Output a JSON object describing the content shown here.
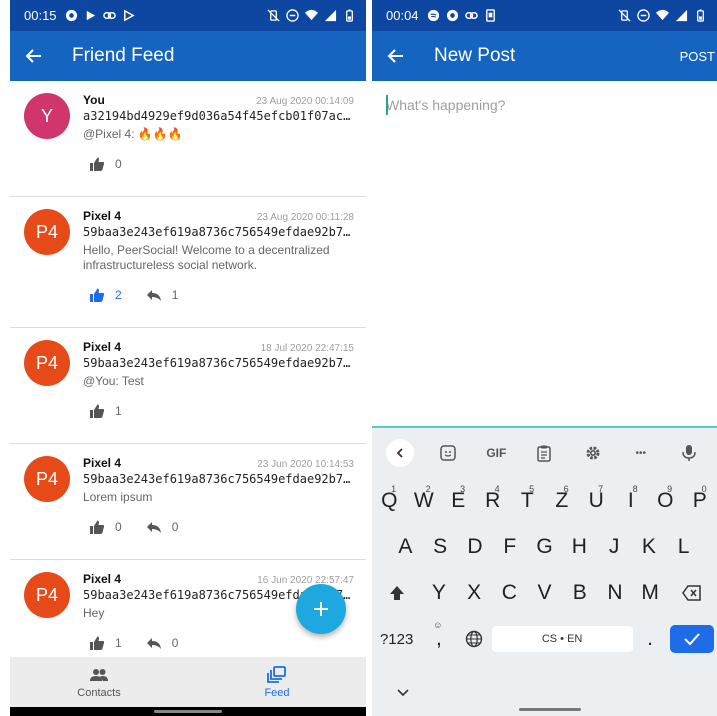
{
  "colors": {
    "statusbar": "#0d47a1",
    "appbar": "#1565c0",
    "accent": "#1e6ce8",
    "fab": "#1fa8e0",
    "avatar_you": "#d0356b",
    "avatar_p4": "#e64a19"
  },
  "left": {
    "status": {
      "time": "00:15"
    },
    "appbar": {
      "title": "Friend Feed"
    },
    "posts": [
      {
        "avatar": "Y",
        "author": "You",
        "date": "23 Aug 2020 00:14:09",
        "hash": "a32194bd4929ef9d036a54f45efcb01f07ac…",
        "message": "@Pixel 4: 🔥🔥🔥",
        "likes": "0",
        "liked": false,
        "replies": null
      },
      {
        "avatar": "P4",
        "author": "Pixel 4",
        "date": "23 Aug 2020 00:11:28",
        "hash": "59baa3e243ef619a8736c756549efdae92b7…",
        "message": "Hello, PeerSocial! Welcome to a decentralized infrastructureless social network.",
        "likes": "2",
        "liked": true,
        "replies": "1"
      },
      {
        "avatar": "P4",
        "author": "Pixel 4",
        "date": "18 Jul 2020 22:47:15",
        "hash": "59baa3e243ef619a8736c756549efdae92b7…",
        "message": "@You: Test",
        "likes": "1",
        "liked": false,
        "replies": null
      },
      {
        "avatar": "P4",
        "author": "Pixel 4",
        "date": "23 Jun 2020 10:14:53",
        "hash": "59baa3e243ef619a8736c756549efdae92b7…",
        "message": "Lorem ipsum",
        "likes": "0",
        "liked": false,
        "replies": "0"
      },
      {
        "avatar": "P4",
        "author": "Pixel 4",
        "date": "16 Jun 2020 22:57:47",
        "hash": "59baa3e243ef619a8736c756549efdae92b7…",
        "message": "Hey",
        "likes": "1",
        "liked": false,
        "replies": "0"
      }
    ],
    "nav": {
      "contacts": "Contacts",
      "feed": "Feed"
    }
  },
  "right": {
    "status": {
      "time": "00:04"
    },
    "appbar": {
      "title": "New Post",
      "action": "POST"
    },
    "compose": {
      "placeholder": "What's happening?"
    },
    "keyboard": {
      "gif": "GIF",
      "more": "•••",
      "row1": [
        [
          "Q",
          "1"
        ],
        [
          "W",
          "2"
        ],
        [
          "E",
          "3"
        ],
        [
          "R",
          "4"
        ],
        [
          "T",
          "5"
        ],
        [
          "Z",
          "6"
        ],
        [
          "U",
          "7"
        ],
        [
          "I",
          "8"
        ],
        [
          "O",
          "9"
        ],
        [
          "P",
          "0"
        ]
      ],
      "row2": [
        "A",
        "S",
        "D",
        "F",
        "G",
        "H",
        "J",
        "K",
        "L"
      ],
      "row3": [
        "Y",
        "X",
        "C",
        "V",
        "B",
        "N",
        "M"
      ],
      "sym": "?123",
      "comma": ",",
      "comma_alt": "☺",
      "space": "CS • EN",
      "period": "."
    }
  }
}
